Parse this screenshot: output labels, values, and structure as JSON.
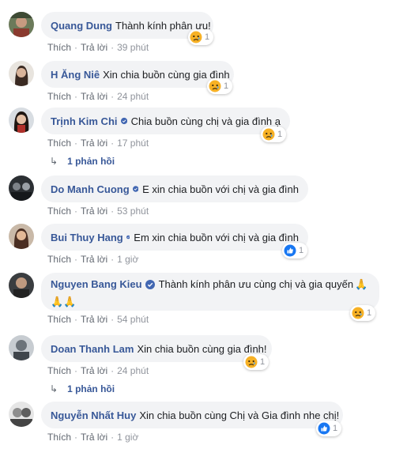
{
  "actions": {
    "like": "Thích",
    "reply": "Trả lời",
    "sep": "·"
  },
  "comments": [
    {
      "name": "Quang Dung",
      "text": "Thành kính phân ưu!",
      "time": "39 phút",
      "reaction_count": "1",
      "reaction": "sad"
    },
    {
      "name": "H Ăng Niê",
      "text": "Xin chia buồn cùng gia đình",
      "time": "24 phút",
      "reaction_count": "1",
      "reaction": "sad"
    },
    {
      "name": "Trịnh Kim Chi",
      "text": "Chia buồn cùng chị và gia đình ạ",
      "time": "17 phút",
      "reaction_count": "1",
      "reaction": "sad",
      "verified": true
    },
    {
      "name": "Do Manh Cuong",
      "text": "E xin chia buồn với chị và gia đình",
      "time": "53 phút",
      "verified": true
    },
    {
      "name": "Bui Thuy Hang",
      "text": "Em xin chia buồn với chị và gia đình",
      "time": "1 giờ",
      "reaction_count": "1",
      "reaction": "like",
      "verified": true
    },
    {
      "name": "Nguyen Bang Kieu",
      "text": "Thành kính phân ưu cùng chị và gia quyến",
      "time": "54 phút",
      "reaction_count": "1",
      "reaction": "sad",
      "verified": true
    },
    {
      "name": "Doan Thanh Lam",
      "text": "Xin chia buồn cùng gia đình!",
      "time": "24 phút",
      "reaction_count": "1",
      "reaction": "sad"
    },
    {
      "name": "Nguyễn Nhất Huy",
      "text": "Xin chia buồn cùng Chị và Gia đình nhe chị!",
      "time": "1 giờ",
      "reaction_count": "1",
      "reaction": "like"
    }
  ],
  "replies_label": "1 phản hồi",
  "icons": {
    "verified": "verified-badge-icon",
    "sad": "sad-emoji-icon",
    "like": "like-thumb-icon",
    "reply_arrow": "reply-arrow-icon",
    "hands": "praying-hands-emoji"
  },
  "colors": {
    "name": "#385898",
    "bubble": "#f2f3f5",
    "meta": "#90949c",
    "verified": "#4267b2",
    "sad": "#f7b125"
  }
}
